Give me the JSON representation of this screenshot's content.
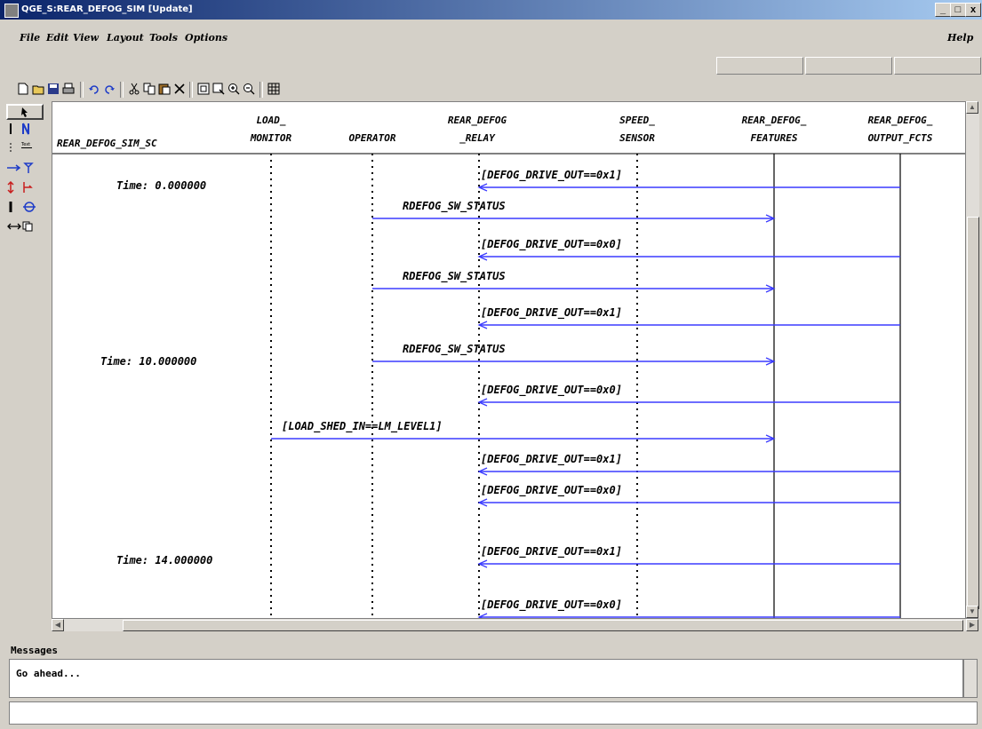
{
  "window": {
    "title": "QGE_S:REAR_DEFOG_SIM  [Update]",
    "min": "_",
    "max": "□",
    "close": "x"
  },
  "menu": {
    "file": "File",
    "edit": "Edit",
    "view": "View",
    "layout": "Layout",
    "tools": "Tools",
    "options": "Options",
    "help": "Help"
  },
  "toolbar_icons": [
    "new-icon",
    "open-icon",
    "save-icon",
    "print-icon",
    "undo-icon",
    "redo-icon",
    "cut-icon",
    "copy-icon",
    "paste-icon",
    "delete-icon",
    "fit-icon",
    "zoom-box-icon",
    "zoom-in-icon",
    "zoom-out-icon",
    "grid-icon"
  ],
  "palette_icons": [
    "select-arrow-icon",
    "instance-line-icon",
    "note-icon",
    "text-icon",
    "condition-icon",
    "message-icon",
    "timer-set-icon",
    "lost-message-icon",
    "timer-icon",
    "action-icon",
    "bidirectional-icon",
    "reference-icon"
  ],
  "palette": {
    "note_text": "Text"
  },
  "diagram": {
    "sc_label": "REAR_DEFOG_SIM_SC",
    "lifelines": [
      {
        "l1": "LOAD_",
        "l2": "MONITOR"
      },
      {
        "l1": "",
        "l2": "OPERATOR"
      },
      {
        "l1": "REAR_DEFOG",
        "l2": "_RELAY"
      },
      {
        "l1": "SPEED_",
        "l2": "SENSOR"
      },
      {
        "l1": "REAR_DEFOG_",
        "l2": "FEATURES"
      },
      {
        "l1": "REAR_DEFOG_",
        "l2": "OUTPUT_FCTS"
      }
    ],
    "times": [
      "Time: 0.000000",
      "Time: 10.000000",
      "Time: 14.000000"
    ],
    "messages": [
      {
        "text": "[DEFOG_DRIVE_OUT==0x1]",
        "from": 5,
        "to": 2
      },
      {
        "text": "RDEFOG_SW_STATUS",
        "from": 1,
        "to": 4
      },
      {
        "text": "[DEFOG_DRIVE_OUT==0x0]",
        "from": 5,
        "to": 2
      },
      {
        "text": "RDEFOG_SW_STATUS",
        "from": 1,
        "to": 4
      },
      {
        "text": "[DEFOG_DRIVE_OUT==0x1]",
        "from": 5,
        "to": 2
      },
      {
        "text": "RDEFOG_SW_STATUS",
        "from": 1,
        "to": 4
      },
      {
        "text": "[DEFOG_DRIVE_OUT==0x0]",
        "from": 5,
        "to": 2
      },
      {
        "text": "[LOAD_SHED_IN==LM_LEVEL1]",
        "from": 0,
        "to": 4
      },
      {
        "text": "[DEFOG_DRIVE_OUT==0x1]",
        "from": 5,
        "to": 2
      },
      {
        "text": "[DEFOG_DRIVE_OUT==0x0]",
        "from": 5,
        "to": 2
      },
      {
        "text": "[DEFOG_DRIVE_OUT==0x1]",
        "from": 5,
        "to": 2
      },
      {
        "text": "[DEFOG_DRIVE_OUT==0x0]",
        "from": 5,
        "to": 2
      }
    ]
  },
  "messages_panel": {
    "label": "Messages",
    "text": "Go ahead..."
  },
  "colors": {
    "arrow": "#3b3bff",
    "titlebar": "#0a246a"
  }
}
